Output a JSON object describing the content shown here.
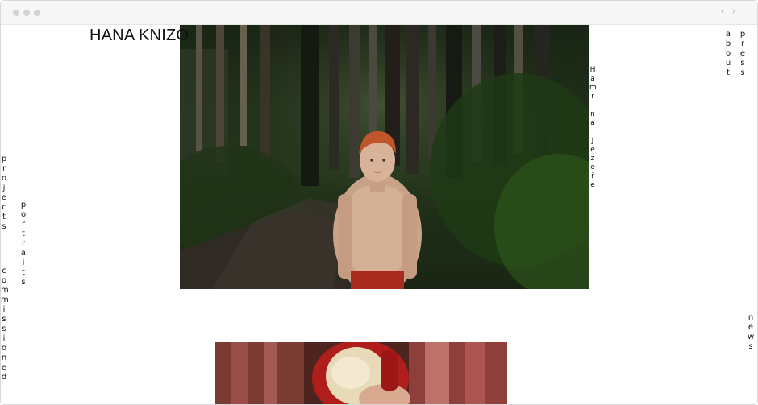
{
  "window": {
    "controls": [
      "close",
      "minimize",
      "maximize"
    ],
    "nav_back_icon": "chevron-left-icon",
    "nav_forward_icon": "chevron-right-icon",
    "nav_back_glyph": "‹",
    "nav_forward_glyph": "›"
  },
  "site": {
    "title": "HANA KNIZO"
  },
  "nav": {
    "projects": "projects",
    "portraits": "portraits",
    "commissioned": "commissioned",
    "about": "about",
    "press": "press",
    "news": "news"
  },
  "photo": {
    "caption": "Hamr na Jezeře",
    "main_subject": "boy in forest",
    "second_subject": "red hair and apple"
  },
  "colors": {
    "text": "#111111",
    "chrome_bg": "#f7f7f7",
    "chrome_dots": "#d3d3d3"
  }
}
